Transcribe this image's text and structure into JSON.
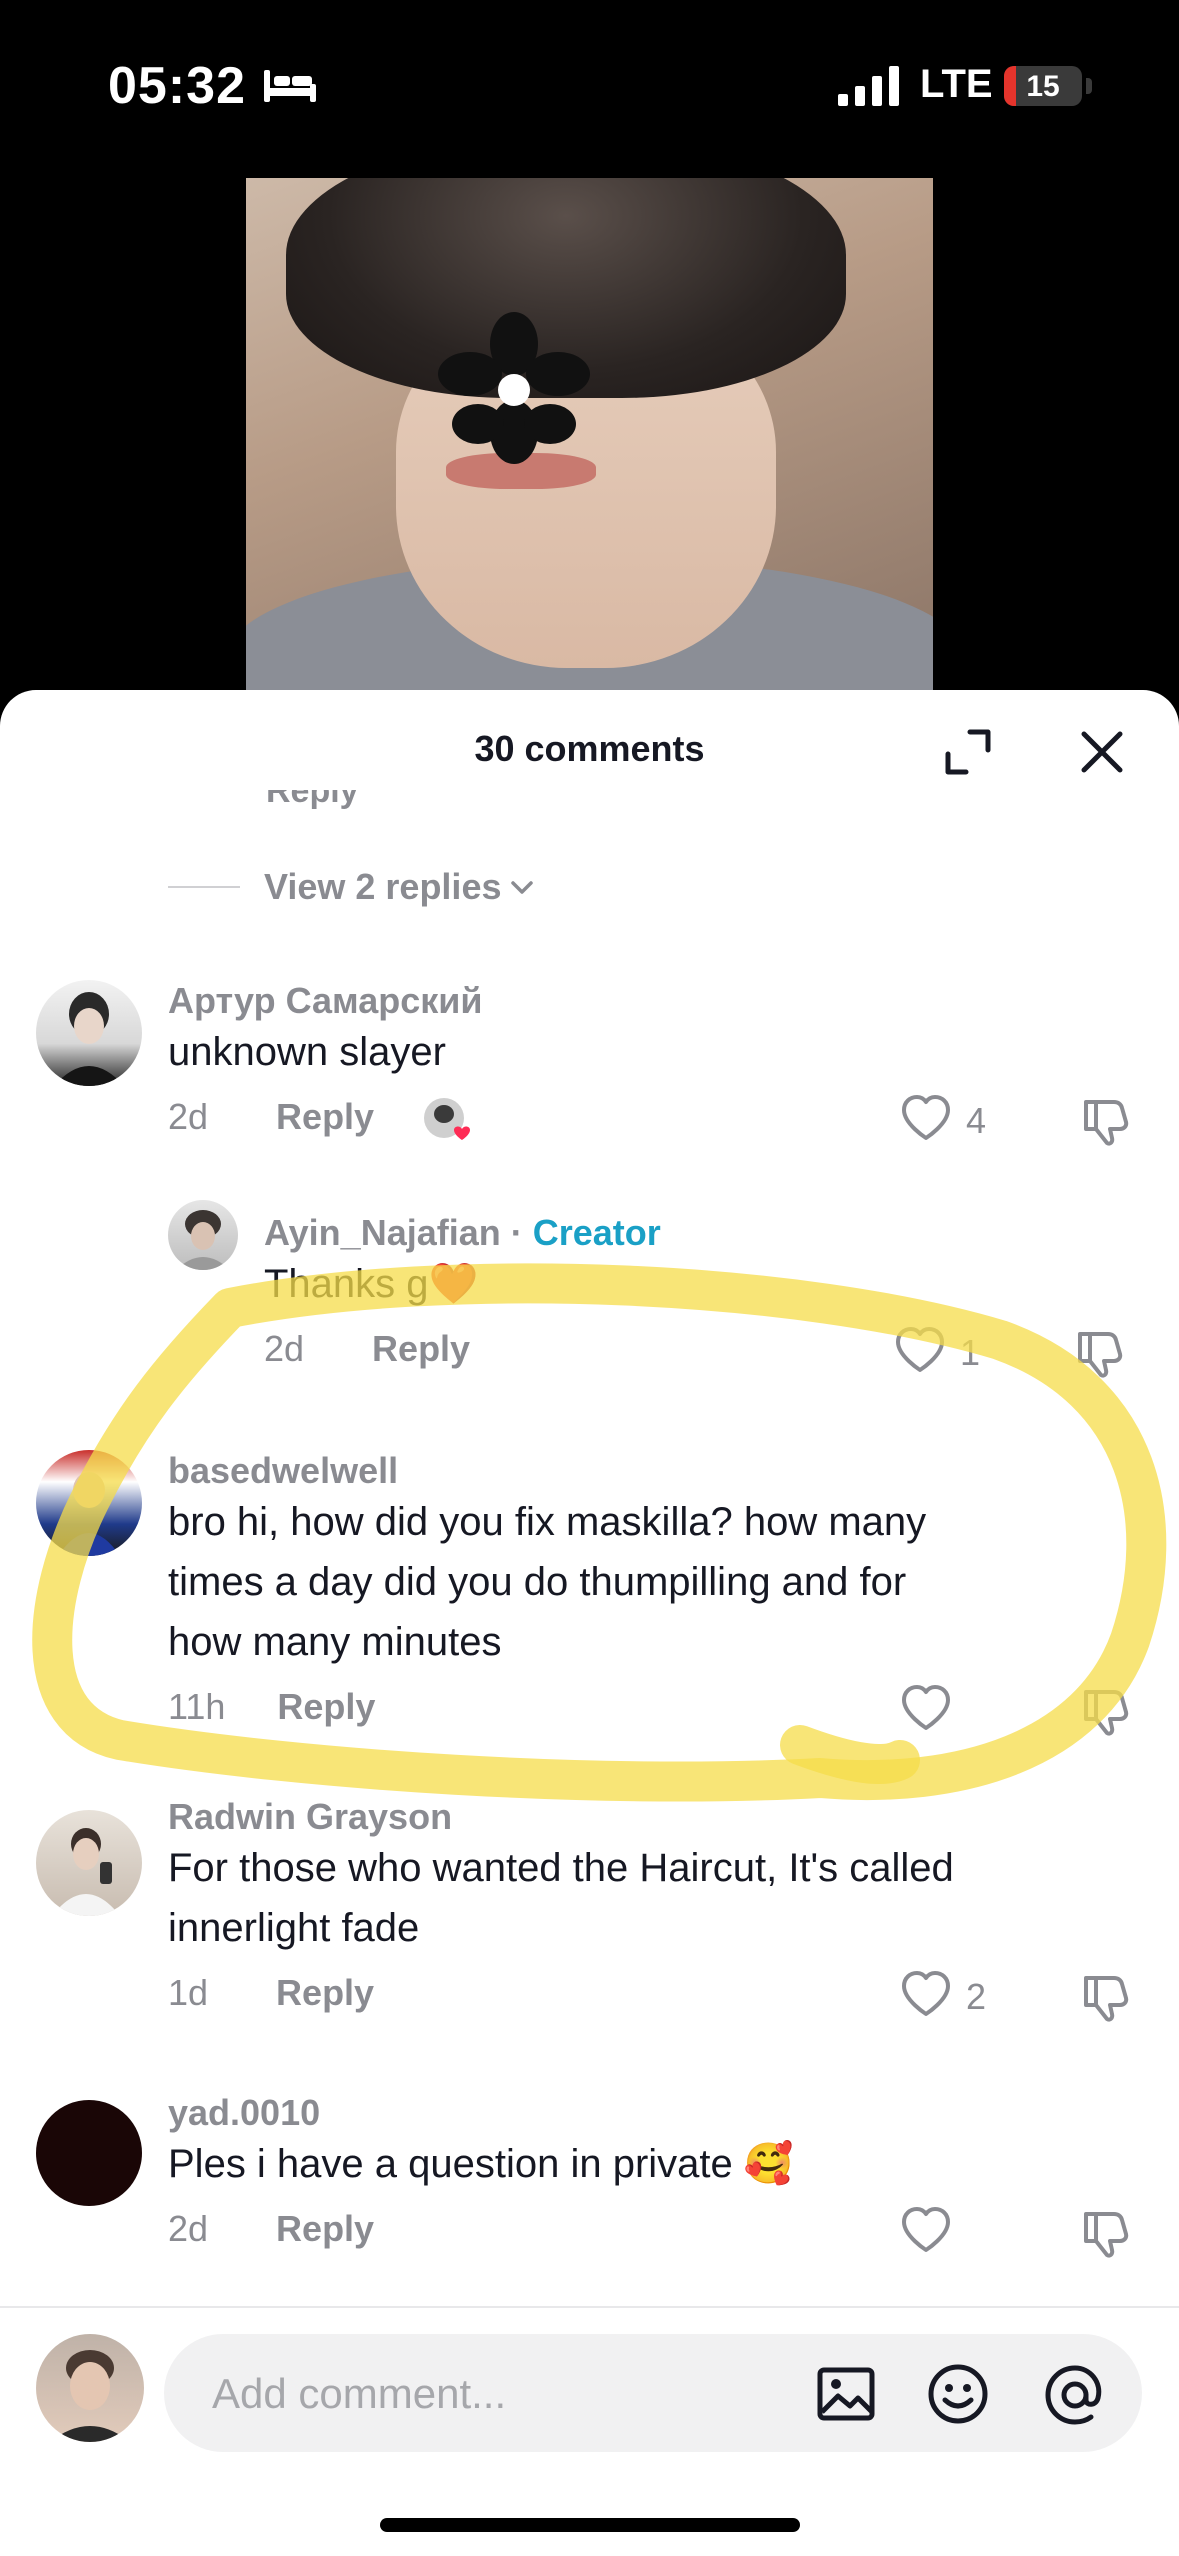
{
  "status_bar": {
    "time": "05:32",
    "network": "LTE",
    "battery": "15",
    "battery_level": 0.15,
    "battery_color": "#e5342c"
  },
  "comments_sheet": {
    "title": "30 comments",
    "partial_text": "Reply",
    "view_replies_label": "View 2 replies",
    "comments": [
      {
        "username": "Артур Самарский",
        "text": "unknown slayer",
        "time": "2d",
        "reply_label": "Reply",
        "likes": "4",
        "creator_liked": true
      },
      {
        "username": "Ayin_Najafian",
        "separator": " · ",
        "badge": "Creator",
        "text": "Thanks g❤️",
        "time": "2d",
        "reply_label": "Reply",
        "likes": "1"
      },
      {
        "username": "basedwelwell",
        "text_lines": [
          "bro hi, how did you fix maskilla? how many",
          "times a day did you do thumpilling and for",
          "how many minutes"
        ],
        "time": "11h",
        "reply_label": "Reply",
        "likes": ""
      },
      {
        "username": "Radwin Grayson",
        "text_lines": [
          "For those who wanted the Haircut, It's called",
          "innerlight fade"
        ],
        "time": "1d",
        "reply_label": "Reply",
        "likes": "2"
      },
      {
        "username": "yad.0010",
        "text": "Ples i have a question in private 🥰",
        "time": "2d",
        "reply_label": "Reply",
        "likes": ""
      }
    ]
  },
  "input_bar": {
    "placeholder": "Add comment..."
  },
  "colors": {
    "creator_accent": "#1aa0c6",
    "highlight": "#f6dc4a"
  },
  "icons": [
    "bed-icon",
    "signal-icon",
    "expand-icon",
    "close-icon",
    "chevron-down-icon",
    "heart-icon",
    "dislike-icon",
    "image-icon",
    "emoji-icon",
    "at-icon"
  ]
}
